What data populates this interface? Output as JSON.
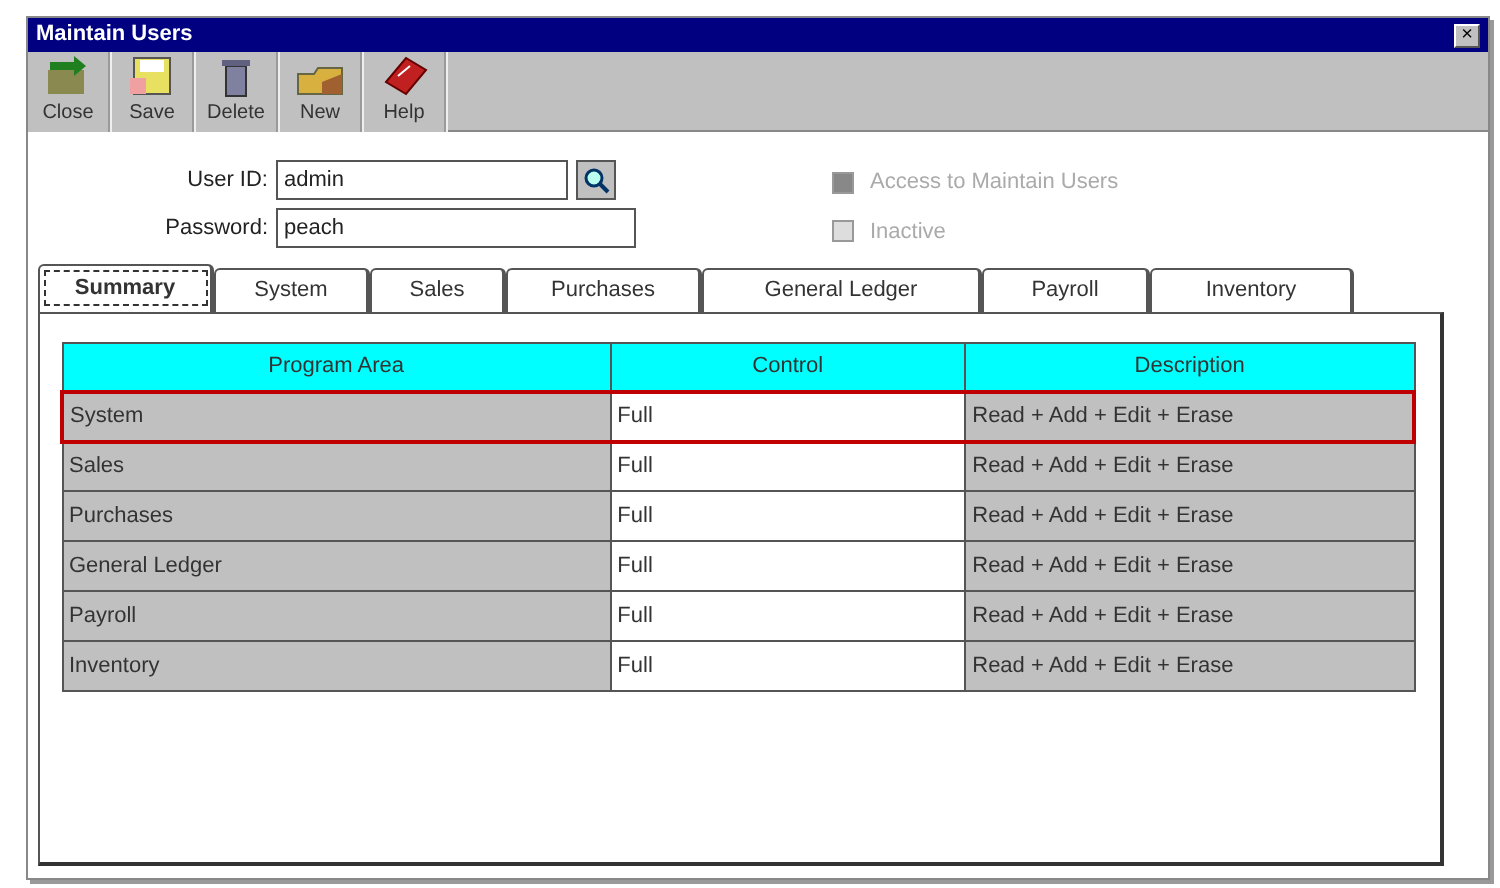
{
  "window": {
    "title": "Maintain Users",
    "close": "×"
  },
  "toolbar": [
    {
      "label": "Close",
      "kind": "close"
    },
    {
      "label": "Save",
      "kind": "save"
    },
    {
      "label": "Delete",
      "kind": "delete"
    },
    {
      "label": "New",
      "kind": "new"
    },
    {
      "label": "Help",
      "kind": "help"
    }
  ],
  "fields": [
    {
      "label": "User ID:",
      "value": "admin",
      "lookup": true
    },
    {
      "label": "Password:",
      "value": "peach",
      "lookup": false
    }
  ],
  "checkboxes": [
    {
      "label": "Access to Maintain Users",
      "checked": true,
      "disabled": true
    },
    {
      "label": "Inactive",
      "checked": false,
      "disabled": true
    }
  ],
  "tabs": [
    {
      "label": "Summary",
      "selected": true
    },
    {
      "label": "System",
      "selected": false
    },
    {
      "label": "Sales",
      "selected": false
    },
    {
      "label": "Purchases",
      "selected": false
    },
    {
      "label": "General Ledger",
      "selected": false
    },
    {
      "label": "Payroll",
      "selected": false
    },
    {
      "label": "Inventory",
      "selected": false
    }
  ],
  "table": {
    "columns": [
      "Program Area",
      "Control",
      "Description"
    ],
    "rows": [
      {
        "cells": [
          "System",
          "Full",
          "Read + Add + Edit + Erase"
        ],
        "selected": true
      },
      {
        "cells": [
          "Sales",
          "Full",
          "Read + Add + Edit + Erase"
        ],
        "selected": false
      },
      {
        "cells": [
          "Purchases",
          "Full",
          "Read + Add + Edit + Erase"
        ],
        "selected": false
      },
      {
        "cells": [
          "General Ledger",
          "Full",
          "Read + Add + Edit + Erase"
        ],
        "selected": false
      },
      {
        "cells": [
          "Payroll",
          "Full",
          "Read + Add + Edit + Erase"
        ],
        "selected": false
      },
      {
        "cells": [
          "Inventory",
          "Full",
          "Read + Add + Edit + Erase"
        ],
        "selected": false
      }
    ]
  }
}
